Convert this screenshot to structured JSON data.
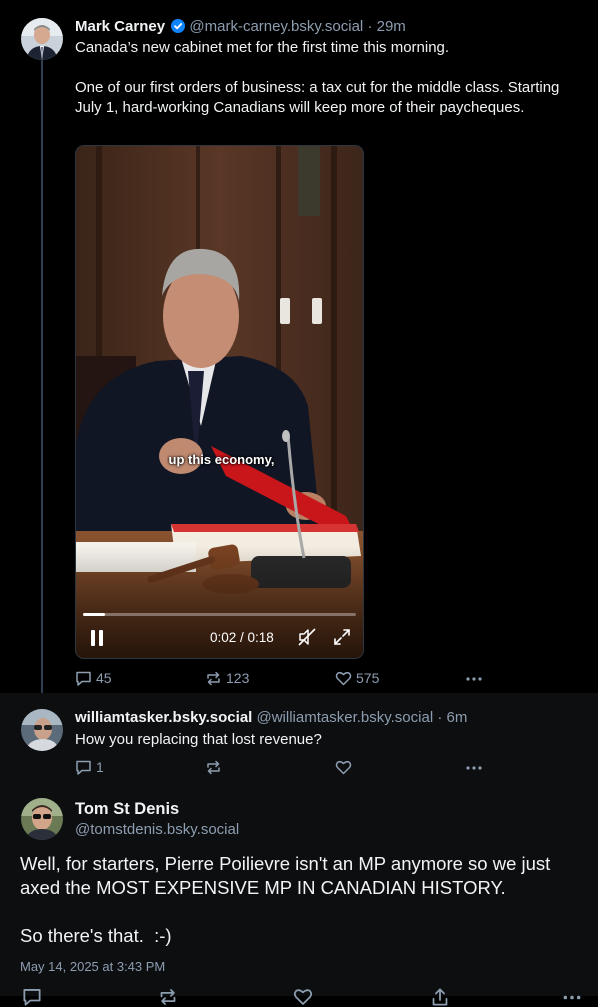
{
  "post1": {
    "display_name": "Mark Carney",
    "verified_icon": "verified-check-icon",
    "handle": "@mark-carney.bsky.social",
    "separator": "·",
    "time": "29m",
    "text_line1": "Canada’s new cabinet met for the first time this morning.",
    "text_para2": "One of our first orders of business: a tax cut for the middle class. Starting July 1, hard-working Canadians will keep more of their paycheques.",
    "video": {
      "caption": "up this economy,",
      "time_display": "0:02 / 0:18",
      "progress": 0.08,
      "play_state_icon": "pause-icon",
      "mute_icon": "muted-speaker-icon",
      "fullscreen_icon": "fullscreen-icon"
    },
    "replies": "45",
    "reposts": "123",
    "likes": "575"
  },
  "post2": {
    "display_name": "williamtasker.bsky.social",
    "handle": "@williamtasker.bsky.social",
    "separator": "·",
    "time": "6m",
    "text": "How you replacing that lost revenue?",
    "replies": "1"
  },
  "post3": {
    "display_name": "Tom St Denis",
    "handle": "@tomstdenis.bsky.social",
    "text_para1": "Well, for starters, Pierre Poilievre isn't an MP anymore so we just axed the MOST EXPENSIVE MP IN CANADIAN HISTORY.",
    "text_para2": "So there's that.  :-)",
    "timestamp": "May 14, 2025 at 3:43 PM"
  },
  "colors": {
    "background": "#000000",
    "reply_background": "#0d0e10",
    "secondary_text": "#8d9db0",
    "thread_line": "#2e4052",
    "verified": "#1083fe"
  }
}
